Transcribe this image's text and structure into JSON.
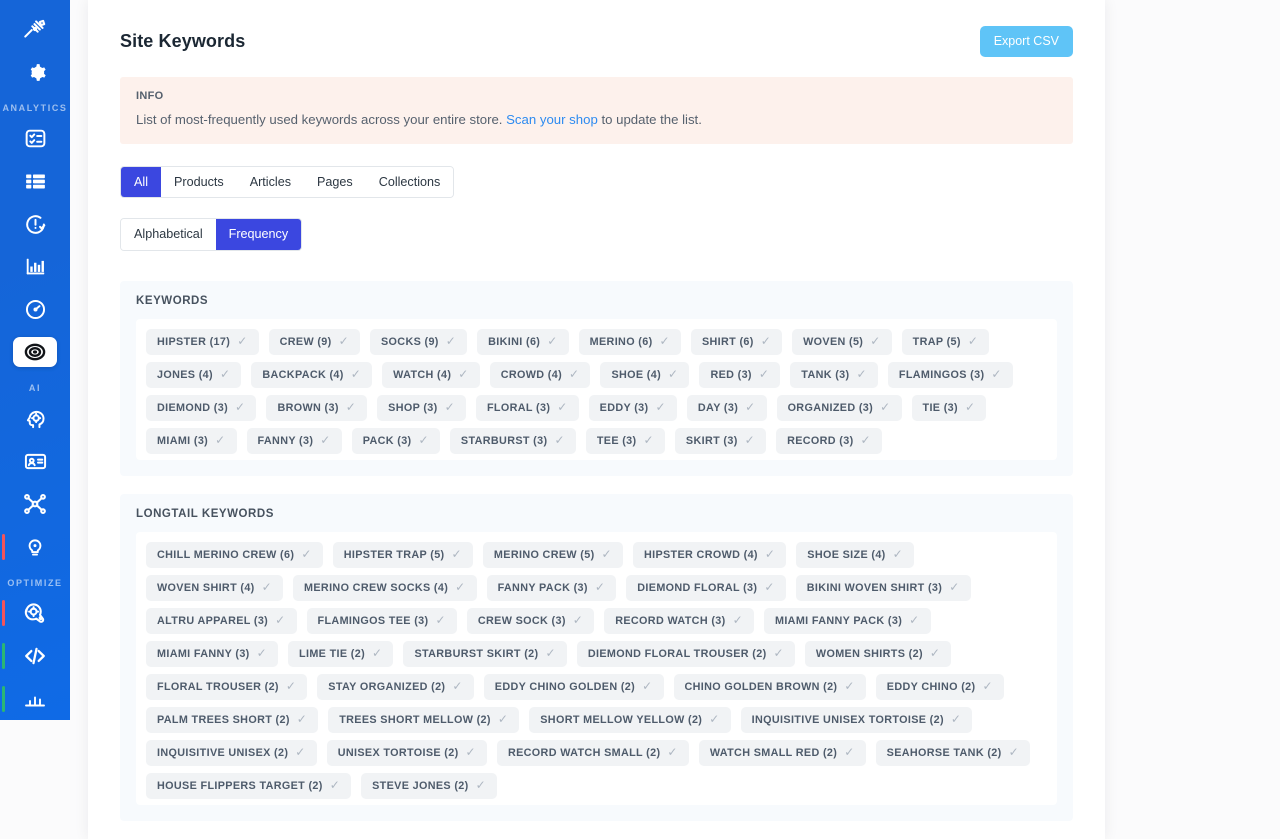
{
  "sidebar": {
    "sections": [
      {
        "label": "",
        "items": [
          {
            "icon": "tools-bug-icon",
            "name": "sidebar-item-tools",
            "active": false,
            "mark": ""
          },
          {
            "icon": "gear-icon",
            "name": "sidebar-item-settings",
            "active": false,
            "mark": ""
          }
        ]
      },
      {
        "label": "ANALYTICS",
        "items": [
          {
            "icon": "checklist-icon",
            "name": "sidebar-item-checklist",
            "active": false,
            "mark": ""
          },
          {
            "icon": "list-grid-icon",
            "name": "sidebar-item-list",
            "active": false,
            "mark": ""
          },
          {
            "icon": "clock-alert-icon",
            "name": "sidebar-item-alerts",
            "active": false,
            "mark": ""
          },
          {
            "icon": "bar-chart-icon",
            "name": "sidebar-item-reports",
            "active": false,
            "mark": ""
          },
          {
            "icon": "speedometer-icon",
            "name": "sidebar-item-speed",
            "active": false,
            "mark": ""
          },
          {
            "icon": "target-icon",
            "name": "sidebar-item-keywords",
            "active": true,
            "mark": ""
          }
        ]
      },
      {
        "label": "AI",
        "items": [
          {
            "icon": "brain-head-icon",
            "name": "sidebar-item-ai-brain",
            "active": false,
            "mark": ""
          },
          {
            "icon": "id-card-icon",
            "name": "sidebar-item-ai-card",
            "active": false,
            "mark": ""
          },
          {
            "icon": "network-nodes-icon",
            "name": "sidebar-item-ai-network",
            "active": false,
            "mark": ""
          },
          {
            "icon": "lightbulb-icon",
            "name": "sidebar-item-ai-insights",
            "active": false,
            "mark": "red"
          }
        ]
      },
      {
        "label": "OPTIMIZE",
        "items": [
          {
            "icon": "gear-badge-icon",
            "name": "sidebar-item-optimize-settings",
            "active": false,
            "mark": "red"
          },
          {
            "icon": "code-icon",
            "name": "sidebar-item-optimize-code",
            "active": false,
            "mark": "green"
          },
          {
            "icon": "partial-icon",
            "name": "sidebar-item-optimize-more",
            "active": false,
            "mark": "green"
          }
        ]
      }
    ]
  },
  "header": {
    "title": "Site Keywords",
    "export_label": "Export CSV",
    "export_color": "#5fc4f7"
  },
  "info": {
    "label": "INFO",
    "text_before": "List of most-frequently used keywords across your entire store. ",
    "link": "Scan your shop",
    "text_after": " to update the list.",
    "background": "#fdf1ec",
    "link_color": "#2d8bf0"
  },
  "filters": {
    "type_tabs": [
      {
        "label": "All",
        "active": true
      },
      {
        "label": "Products",
        "active": false
      },
      {
        "label": "Articles",
        "active": false
      },
      {
        "label": "Pages",
        "active": false
      },
      {
        "label": "Collections",
        "active": false
      }
    ],
    "sort_tabs": [
      {
        "label": "Alphabetical",
        "active": false
      },
      {
        "label": "Frequency",
        "active": true
      }
    ],
    "active_color": "#3b47e0"
  },
  "panels": [
    {
      "title": "KEYWORDS",
      "name": "keywords-panel",
      "tags": [
        {
          "term": "HIPSTER",
          "count": 17,
          "label": "HIPSTER (17)"
        },
        {
          "term": "CREW",
          "count": 9,
          "label": "CREW (9)"
        },
        {
          "term": "SOCKS",
          "count": 9,
          "label": "SOCKS (9)"
        },
        {
          "term": "BIKINI",
          "count": 6,
          "label": "BIKINI (6)"
        },
        {
          "term": "MERINO",
          "count": 6,
          "label": "MERINO (6)"
        },
        {
          "term": "SHIRT",
          "count": 6,
          "label": "SHIRT (6)"
        },
        {
          "term": "WOVEN",
          "count": 5,
          "label": "WOVEN (5)"
        },
        {
          "term": "TRAP",
          "count": 5,
          "label": "TRAP (5)"
        },
        {
          "term": "JONES",
          "count": 4,
          "label": "JONES (4)"
        },
        {
          "term": "BACKPACK",
          "count": 4,
          "label": "BACKPACK (4)"
        },
        {
          "term": "WATCH",
          "count": 4,
          "label": "WATCH (4)"
        },
        {
          "term": "CROWD",
          "count": 4,
          "label": "CROWD (4)"
        },
        {
          "term": "SHOE",
          "count": 4,
          "label": "SHOE (4)"
        },
        {
          "term": "RED",
          "count": 3,
          "label": "RED (3)"
        },
        {
          "term": "TANK",
          "count": 3,
          "label": "TANK (3)"
        },
        {
          "term": "FLAMINGOS",
          "count": 3,
          "label": "FLAMINGOS (3)"
        },
        {
          "term": "DIEMOND",
          "count": 3,
          "label": "DIEMOND (3)"
        },
        {
          "term": "BROWN",
          "count": 3,
          "label": "BROWN (3)"
        },
        {
          "term": "SHOP",
          "count": 3,
          "label": "SHOP (3)"
        },
        {
          "term": "FLORAL",
          "count": 3,
          "label": "FLORAL (3)"
        },
        {
          "term": "EDDY",
          "count": 3,
          "label": "EDDY (3)"
        },
        {
          "term": "DAY",
          "count": 3,
          "label": "DAY (3)"
        },
        {
          "term": "ORGANIZED",
          "count": 3,
          "label": "ORGANIZED (3)"
        },
        {
          "term": "TIE",
          "count": 3,
          "label": "TIE (3)"
        },
        {
          "term": "MIAMI",
          "count": 3,
          "label": "MIAMI (3)"
        },
        {
          "term": "FANNY",
          "count": 3,
          "label": "FANNY (3)"
        },
        {
          "term": "PACK",
          "count": 3,
          "label": "PACK (3)"
        },
        {
          "term": "STARBURST",
          "count": 3,
          "label": "STARBURST (3)"
        },
        {
          "term": "TEE",
          "count": 3,
          "label": "TEE (3)"
        },
        {
          "term": "SKIRT",
          "count": 3,
          "label": "SKIRT (3)"
        },
        {
          "term": "RECORD",
          "count": 3,
          "label": "RECORD (3)"
        }
      ]
    },
    {
      "title": "LONGTAIL KEYWORDS",
      "name": "longtail-keywords-panel",
      "tags": [
        {
          "term": "CHILL MERINO CREW",
          "count": 6,
          "label": "CHILL MERINO CREW (6)"
        },
        {
          "term": "HIPSTER TRAP",
          "count": 5,
          "label": "HIPSTER TRAP (5)"
        },
        {
          "term": "MERINO CREW",
          "count": 5,
          "label": "MERINO CREW (5)"
        },
        {
          "term": "HIPSTER CROWD",
          "count": 4,
          "label": "HIPSTER CROWD (4)"
        },
        {
          "term": "SHOE SIZE",
          "count": 4,
          "label": "SHOE SIZE (4)"
        },
        {
          "term": "WOVEN SHIRT",
          "count": 4,
          "label": "WOVEN SHIRT (4)"
        },
        {
          "term": "MERINO CREW SOCKS",
          "count": 4,
          "label": "MERINO CREW SOCKS (4)"
        },
        {
          "term": "FANNY PACK",
          "count": 3,
          "label": "FANNY PACK (3)"
        },
        {
          "term": "DIEMOND FLORAL",
          "count": 3,
          "label": "DIEMOND FLORAL (3)"
        },
        {
          "term": "BIKINI WOVEN SHIRT",
          "count": 3,
          "label": "BIKINI WOVEN SHIRT (3)"
        },
        {
          "term": "ALTRU APPAREL",
          "count": 3,
          "label": "ALTRU APPAREL (3)"
        },
        {
          "term": "FLAMINGOS TEE",
          "count": 3,
          "label": "FLAMINGOS TEE (3)"
        },
        {
          "term": "CREW SOCK",
          "count": 3,
          "label": "CREW SOCK (3)"
        },
        {
          "term": "RECORD WATCH",
          "count": 3,
          "label": "RECORD WATCH (3)"
        },
        {
          "term": "MIAMI FANNY PACK",
          "count": 3,
          "label": "MIAMI FANNY PACK (3)"
        },
        {
          "term": "MIAMI FANNY",
          "count": 3,
          "label": "MIAMI FANNY (3)"
        },
        {
          "term": "LIME TIE",
          "count": 2,
          "label": "LIME TIE (2)"
        },
        {
          "term": "STARBURST SKIRT",
          "count": 2,
          "label": "STARBURST SKIRT (2)"
        },
        {
          "term": "DIEMOND FLORAL TROUSER",
          "count": 2,
          "label": "DIEMOND FLORAL TROUSER (2)"
        },
        {
          "term": "WOMEN SHIRTS",
          "count": 2,
          "label": "WOMEN SHIRTS (2)"
        },
        {
          "term": "FLORAL TROUSER",
          "count": 2,
          "label": "FLORAL TROUSER (2)"
        },
        {
          "term": "STAY ORGANIZED",
          "count": 2,
          "label": "STAY ORGANIZED (2)"
        },
        {
          "term": "EDDY CHINO GOLDEN",
          "count": 2,
          "label": "EDDY CHINO GOLDEN (2)"
        },
        {
          "term": "CHINO GOLDEN BROWN",
          "count": 2,
          "label": "CHINO GOLDEN BROWN (2)"
        },
        {
          "term": "EDDY CHINO",
          "count": 2,
          "label": "EDDY CHINO (2)"
        },
        {
          "term": "PALM TREES SHORT",
          "count": 2,
          "label": "PALM TREES SHORT (2)"
        },
        {
          "term": "TREES SHORT MELLOW",
          "count": 2,
          "label": "TREES SHORT MELLOW (2)"
        },
        {
          "term": "SHORT MELLOW YELLOW",
          "count": 2,
          "label": "SHORT MELLOW YELLOW (2)"
        },
        {
          "term": "INQUISITIVE UNISEX TORTOISE",
          "count": 2,
          "label": "INQUISITIVE UNISEX TORTOISE (2)"
        },
        {
          "term": "INQUISITIVE UNISEX",
          "count": 2,
          "label": "INQUISITIVE UNISEX (2)"
        },
        {
          "term": "UNISEX TORTOISE",
          "count": 2,
          "label": "UNISEX TORTOISE (2)"
        },
        {
          "term": "RECORD WATCH SMALL",
          "count": 2,
          "label": "RECORD WATCH SMALL (2)"
        },
        {
          "term": "WATCH SMALL RED",
          "count": 2,
          "label": "WATCH SMALL RED (2)"
        },
        {
          "term": "SEAHORSE TANK",
          "count": 2,
          "label": "SEAHORSE TANK (2)"
        },
        {
          "term": "HOUSE FLIPPERS TARGET",
          "count": 2,
          "label": "HOUSE FLIPPERS TARGET (2)"
        },
        {
          "term": "STEVE JONES",
          "count": 2,
          "label": "STEVE JONES (2)"
        }
      ]
    }
  ],
  "icons": {
    "tag_check": "✓"
  }
}
